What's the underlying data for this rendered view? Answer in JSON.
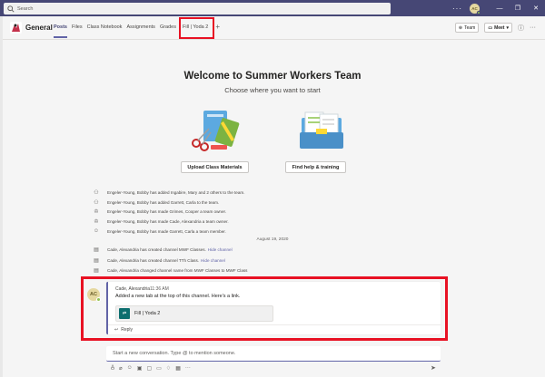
{
  "titlebar": {
    "search_placeholder": "Search",
    "more": "···",
    "avatar_initials": "AC",
    "minimize": "—",
    "restore": "❐",
    "close": "✕"
  },
  "channel": {
    "name": "General",
    "tabs": [
      {
        "label": "Posts"
      },
      {
        "label": "Files"
      },
      {
        "label": "Class Notebook"
      },
      {
        "label": "Assignments"
      },
      {
        "label": "Grades"
      },
      {
        "label": "Fill | Yoda 2"
      }
    ],
    "add_tab": "+",
    "team_button": "Team",
    "meet_button": "Meet",
    "chevron": "▾"
  },
  "welcome": {
    "title": "Welcome to Summer Workers Team",
    "subtitle": "Choose where you want to start",
    "upload_button": "Upload Class Materials",
    "help_button": "Find help & training"
  },
  "activity": [
    {
      "icon": "person-add-icon",
      "glyph": "👤",
      "text": "Engeler-Young, Bobby has added Ingabire, Mary and 2 others to the team."
    },
    {
      "icon": "person-add-icon",
      "glyph": "👤",
      "text": "Engeler-Young, Bobby has added Garrett, Carla to the team."
    },
    {
      "icon": "crown-icon",
      "glyph": "♔",
      "text": "Engeler-Young, Bobby has made Grimes, Cooper a team owner."
    },
    {
      "icon": "crown-icon",
      "glyph": "♔",
      "text": "Engeler-Young, Bobby has made Cade, Alexandria a team owner."
    },
    {
      "icon": "person-icon",
      "glyph": "👤",
      "text": "Engeler-Young, Bobby has made Garrett, Carla a team member."
    }
  ],
  "date_separator": "August 19, 2020",
  "channel_activity": [
    {
      "icon": "channel-icon",
      "text": "Cade, Alexandria has created channel MWF Classes.",
      "link": "Hide channel"
    },
    {
      "icon": "channel-icon",
      "text": "Cade, Alexandria has created channel TTh Class.",
      "link": "Hide channel"
    },
    {
      "icon": "channel-icon",
      "text": "Cade, Alexandria changed channel name from MWF Classes to MWF Class",
      "link": ""
    }
  ],
  "post": {
    "avatar_initials": "AC",
    "author": "Cade, Alexandria",
    "time": "11:36 AM",
    "text": "Added a new tab at the top of this channel. Here's a link.",
    "tab_card_label": "Fill | Yoda 2",
    "reply_label": "Reply"
  },
  "compose": {
    "placeholder": "Start a new conversation. Type @ to mention someone."
  },
  "colors": {
    "brand": "#464775",
    "accent": "#6264a7",
    "highlight": "#e81123"
  }
}
